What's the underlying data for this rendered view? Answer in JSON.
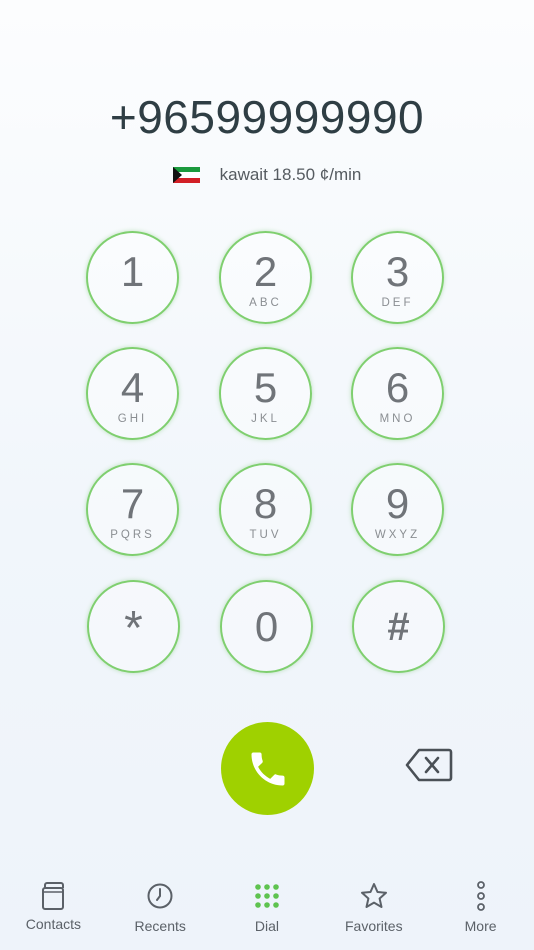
{
  "dialer": {
    "number": "+96599999990",
    "rate_text": "kawait 18.50 ¢/min"
  },
  "keypad": [
    {
      "digit": "1",
      "letters": ""
    },
    {
      "digit": "2",
      "letters": "ABC"
    },
    {
      "digit": "3",
      "letters": "DEF"
    },
    {
      "digit": "4",
      "letters": "GHI"
    },
    {
      "digit": "5",
      "letters": "JKL"
    },
    {
      "digit": "6",
      "letters": "MNO"
    },
    {
      "digit": "7",
      "letters": "PQRS"
    },
    {
      "digit": "8",
      "letters": "TUV"
    },
    {
      "digit": "9",
      "letters": "WXYZ"
    },
    {
      "digit": "*",
      "letters": ""
    },
    {
      "digit": "0",
      "letters": ""
    },
    {
      "digit": "#",
      "letters": ""
    }
  ],
  "actions": {
    "call_icon": "phone-icon",
    "backspace_icon": "backspace-icon"
  },
  "tabs": [
    {
      "label": "Contacts",
      "icon": "book-icon"
    },
    {
      "label": "Recents",
      "icon": "clock-icon"
    },
    {
      "label": "Dial",
      "icon": "dialpad-icon",
      "active": true
    },
    {
      "label": "Favorites",
      "icon": "star-icon"
    },
    {
      "label": "More",
      "icon": "more-icon"
    }
  ],
  "colors": {
    "key_border": "#7fcf6f",
    "call_button": "#9fd100",
    "active_tab": "#5ec34f"
  }
}
